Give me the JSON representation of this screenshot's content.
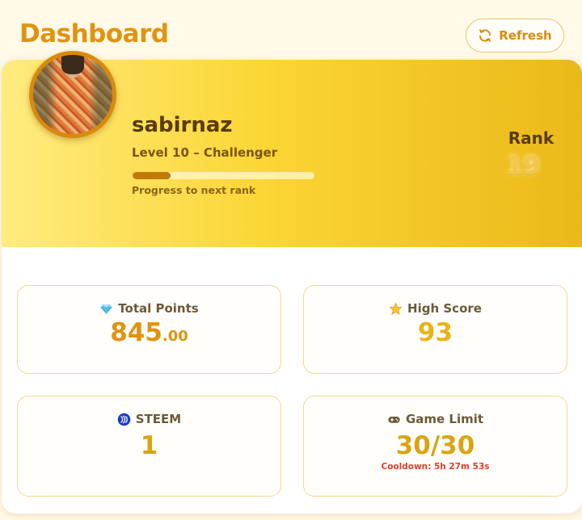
{
  "header": {
    "title": "Dashboard",
    "refresh_label": "Refresh"
  },
  "profile": {
    "username": "sabirnaz",
    "level_text": "Level 10 – Challenger",
    "progress_fraction": 0.21,
    "progress_label": "Progress to next rank",
    "rank_label": "Rank",
    "rank_value": "19"
  },
  "stats": {
    "total_points": {
      "label": "Total Points",
      "integer": "845",
      "decimal": ".00",
      "icon": "gem-icon"
    },
    "high_score": {
      "label": "High Score",
      "value": "93",
      "icon": "star-icon"
    },
    "steem": {
      "label": "STEEM",
      "value": "1",
      "icon": "steem-icon"
    },
    "game_limit": {
      "label": "Game Limit",
      "value": "30/30",
      "cooldown": "Cooldown: 5h 27m 53s",
      "icon": "gamepad-icon"
    }
  },
  "colors": {
    "accent": "#e0930e",
    "cooldown": "#e23a2a",
    "steem_blue": "#1a3cc9"
  }
}
